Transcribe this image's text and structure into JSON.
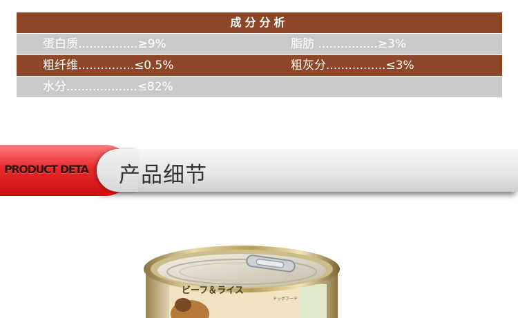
{
  "nutrition": {
    "title": "成分分析",
    "rows": [
      {
        "left_name": "蛋白质",
        "left_dots": "................",
        "left_value": "≥9%",
        "right_name": "脂肪",
        "right_dots": " ................",
        "right_value": "≥3%"
      },
      {
        "left_name": "粗纤维",
        "left_dots": "...............",
        "left_value": "≤0.5%",
        "right_name": "粗灰分",
        "right_dots": "................",
        "right_value": "≤3%"
      },
      {
        "left_name": "水分",
        "left_dots": "...................",
        "left_value": "≤82%",
        "right_name": "",
        "right_dots": "",
        "right_value": ""
      }
    ]
  },
  "banner": {
    "tag": "PRODUCT DETA",
    "heading": "产品细节"
  },
  "product": {
    "label_main": "ビーフ＆ライス",
    "label_sub": "ドッグフード"
  }
}
